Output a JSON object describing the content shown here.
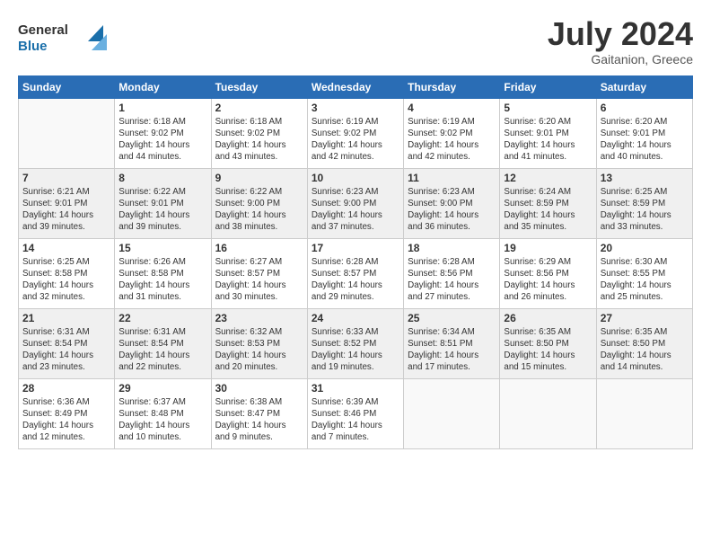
{
  "header": {
    "logo_general": "General",
    "logo_blue": "Blue",
    "month_year": "July 2024",
    "location": "Gaitanion, Greece"
  },
  "weekdays": [
    "Sunday",
    "Monday",
    "Tuesday",
    "Wednesday",
    "Thursday",
    "Friday",
    "Saturday"
  ],
  "weeks": [
    [
      {
        "day": "",
        "info": ""
      },
      {
        "day": "1",
        "info": "Sunrise: 6:18 AM\nSunset: 9:02 PM\nDaylight: 14 hours\nand 44 minutes."
      },
      {
        "day": "2",
        "info": "Sunrise: 6:18 AM\nSunset: 9:02 PM\nDaylight: 14 hours\nand 43 minutes."
      },
      {
        "day": "3",
        "info": "Sunrise: 6:19 AM\nSunset: 9:02 PM\nDaylight: 14 hours\nand 42 minutes."
      },
      {
        "day": "4",
        "info": "Sunrise: 6:19 AM\nSunset: 9:02 PM\nDaylight: 14 hours\nand 42 minutes."
      },
      {
        "day": "5",
        "info": "Sunrise: 6:20 AM\nSunset: 9:01 PM\nDaylight: 14 hours\nand 41 minutes."
      },
      {
        "day": "6",
        "info": "Sunrise: 6:20 AM\nSunset: 9:01 PM\nDaylight: 14 hours\nand 40 minutes."
      }
    ],
    [
      {
        "day": "7",
        "info": "Sunrise: 6:21 AM\nSunset: 9:01 PM\nDaylight: 14 hours\nand 39 minutes."
      },
      {
        "day": "8",
        "info": "Sunrise: 6:22 AM\nSunset: 9:01 PM\nDaylight: 14 hours\nand 39 minutes."
      },
      {
        "day": "9",
        "info": "Sunrise: 6:22 AM\nSunset: 9:00 PM\nDaylight: 14 hours\nand 38 minutes."
      },
      {
        "day": "10",
        "info": "Sunrise: 6:23 AM\nSunset: 9:00 PM\nDaylight: 14 hours\nand 37 minutes."
      },
      {
        "day": "11",
        "info": "Sunrise: 6:23 AM\nSunset: 9:00 PM\nDaylight: 14 hours\nand 36 minutes."
      },
      {
        "day": "12",
        "info": "Sunrise: 6:24 AM\nSunset: 8:59 PM\nDaylight: 14 hours\nand 35 minutes."
      },
      {
        "day": "13",
        "info": "Sunrise: 6:25 AM\nSunset: 8:59 PM\nDaylight: 14 hours\nand 33 minutes."
      }
    ],
    [
      {
        "day": "14",
        "info": "Sunrise: 6:25 AM\nSunset: 8:58 PM\nDaylight: 14 hours\nand 32 minutes."
      },
      {
        "day": "15",
        "info": "Sunrise: 6:26 AM\nSunset: 8:58 PM\nDaylight: 14 hours\nand 31 minutes."
      },
      {
        "day": "16",
        "info": "Sunrise: 6:27 AM\nSunset: 8:57 PM\nDaylight: 14 hours\nand 30 minutes."
      },
      {
        "day": "17",
        "info": "Sunrise: 6:28 AM\nSunset: 8:57 PM\nDaylight: 14 hours\nand 29 minutes."
      },
      {
        "day": "18",
        "info": "Sunrise: 6:28 AM\nSunset: 8:56 PM\nDaylight: 14 hours\nand 27 minutes."
      },
      {
        "day": "19",
        "info": "Sunrise: 6:29 AM\nSunset: 8:56 PM\nDaylight: 14 hours\nand 26 minutes."
      },
      {
        "day": "20",
        "info": "Sunrise: 6:30 AM\nSunset: 8:55 PM\nDaylight: 14 hours\nand 25 minutes."
      }
    ],
    [
      {
        "day": "21",
        "info": "Sunrise: 6:31 AM\nSunset: 8:54 PM\nDaylight: 14 hours\nand 23 minutes."
      },
      {
        "day": "22",
        "info": "Sunrise: 6:31 AM\nSunset: 8:54 PM\nDaylight: 14 hours\nand 22 minutes."
      },
      {
        "day": "23",
        "info": "Sunrise: 6:32 AM\nSunset: 8:53 PM\nDaylight: 14 hours\nand 20 minutes."
      },
      {
        "day": "24",
        "info": "Sunrise: 6:33 AM\nSunset: 8:52 PM\nDaylight: 14 hours\nand 19 minutes."
      },
      {
        "day": "25",
        "info": "Sunrise: 6:34 AM\nSunset: 8:51 PM\nDaylight: 14 hours\nand 17 minutes."
      },
      {
        "day": "26",
        "info": "Sunrise: 6:35 AM\nSunset: 8:50 PM\nDaylight: 14 hours\nand 15 minutes."
      },
      {
        "day": "27",
        "info": "Sunrise: 6:35 AM\nSunset: 8:50 PM\nDaylight: 14 hours\nand 14 minutes."
      }
    ],
    [
      {
        "day": "28",
        "info": "Sunrise: 6:36 AM\nSunset: 8:49 PM\nDaylight: 14 hours\nand 12 minutes."
      },
      {
        "day": "29",
        "info": "Sunrise: 6:37 AM\nSunset: 8:48 PM\nDaylight: 14 hours\nand 10 minutes."
      },
      {
        "day": "30",
        "info": "Sunrise: 6:38 AM\nSunset: 8:47 PM\nDaylight: 14 hours\nand 9 minutes."
      },
      {
        "day": "31",
        "info": "Sunrise: 6:39 AM\nSunset: 8:46 PM\nDaylight: 14 hours\nand 7 minutes."
      },
      {
        "day": "",
        "info": ""
      },
      {
        "day": "",
        "info": ""
      },
      {
        "day": "",
        "info": ""
      }
    ]
  ]
}
